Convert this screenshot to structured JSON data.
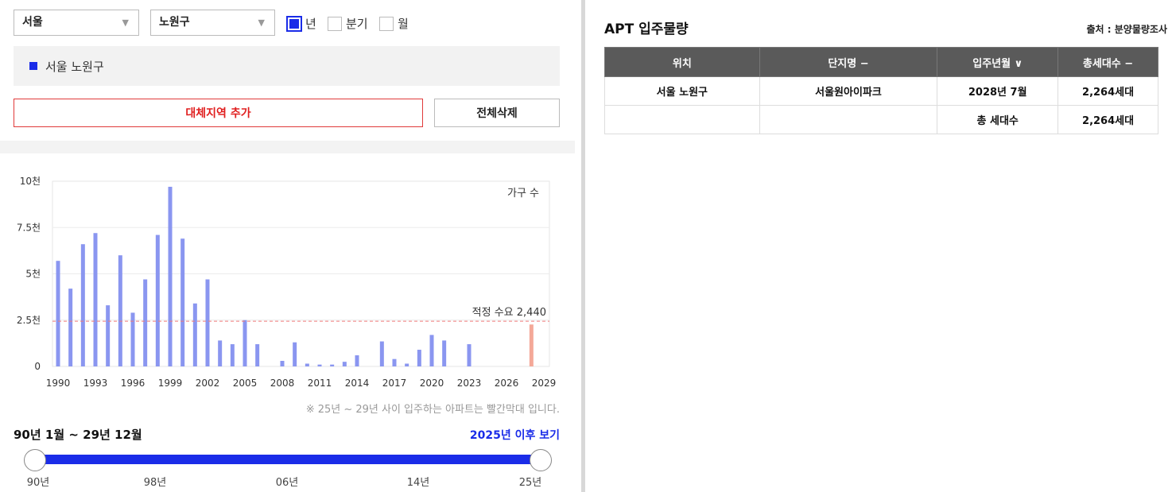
{
  "filters": {
    "city": "서울",
    "district": "노원구",
    "periods": [
      {
        "label": "년",
        "checked": true
      },
      {
        "label": "분기",
        "checked": false
      },
      {
        "label": "월",
        "checked": false
      }
    ]
  },
  "selected_region": "서울 노원구",
  "buttons": {
    "add_region": "대체지역 추가",
    "delete_all": "전체삭제"
  },
  "chart_data": {
    "type": "bar",
    "legend_label": "가구 수",
    "x_tick_labels": [
      "1990",
      "1993",
      "1996",
      "1999",
      "2002",
      "2005",
      "2008",
      "2011",
      "2014",
      "2017",
      "2020",
      "2023",
      "2026",
      "2029"
    ],
    "y_tick_labels": [
      "0",
      "2.5천",
      "5천",
      "7.5천",
      "10천"
    ],
    "ylim": [
      0,
      10000
    ],
    "xlim": [
      1990,
      2029
    ],
    "series": [
      {
        "x": [
          1990,
          1991,
          1992,
          1993,
          1994,
          1995,
          1996,
          1997,
          1998,
          1999,
          2000,
          2001,
          2002,
          2003,
          2004,
          2005,
          2006,
          2008,
          2009,
          2010,
          2011,
          2012,
          2013,
          2014,
          2016,
          2017,
          2018,
          2019,
          2020,
          2021,
          2023
        ],
        "values": [
          5700,
          4200,
          6600,
          7200,
          3300,
          6000,
          2900,
          4700,
          7100,
          9700,
          6900,
          3400,
          4700,
          1400,
          1200,
          2500,
          1200,
          300,
          1300,
          150,
          100,
          100,
          250,
          600,
          1350,
          400,
          150,
          900,
          1700,
          1400,
          1200
        ],
        "color": "#8a96f0"
      },
      {
        "x": [
          2028
        ],
        "values": [
          2264
        ],
        "color": "#f4a898"
      }
    ],
    "reference_line": {
      "value": 2440,
      "label": "적정 수요 2,440",
      "color": "#f07a7a"
    },
    "grid": true
  },
  "note": "※ 25년 ~ 29년 사이 입주하는 아파트는 빨간막대 입니다.",
  "range": {
    "label": "90년 1월 ~ 29년 12월",
    "after_link": "2025년 이후 보기",
    "slider_start_fraction": 0,
    "slider_end_fraction": 1,
    "ticks": [
      "90년",
      "98년",
      "06년",
      "14년",
      "25년"
    ]
  },
  "right_panel": {
    "title": "APT 입주물량",
    "source": "출처 : 분양물량조사",
    "columns": [
      "위치",
      "단지명 −",
      "입주년월 ∨",
      "총세대수 −"
    ],
    "rows": [
      [
        "서울 노원구",
        "서울원아이파크",
        "2028년 7월",
        "2,264세대"
      ],
      [
        "",
        "",
        "총 세대수",
        "2,264세대"
      ]
    ]
  },
  "colors": {
    "accent": "#1a2ce8",
    "alert": "#e01e1e",
    "table_header": "#5a5a5a"
  }
}
